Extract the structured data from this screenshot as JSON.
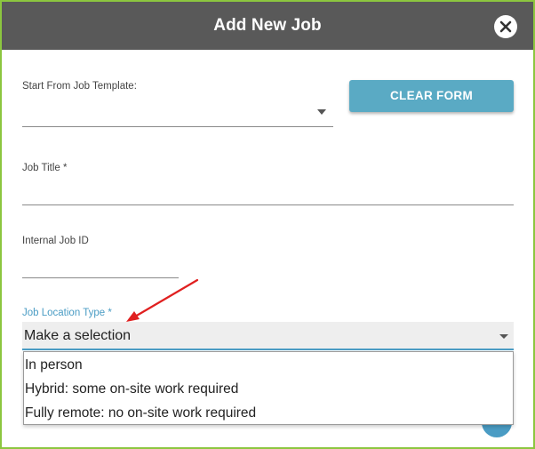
{
  "dialog": {
    "title": "Add New Job",
    "close_icon": "close-icon"
  },
  "form": {
    "template": {
      "label": "Start From Job Template:",
      "value": ""
    },
    "clear_button_label": "CLEAR FORM",
    "job_title": {
      "label": "Job Title *",
      "value": ""
    },
    "internal_id": {
      "label": "Internal Job ID",
      "value": ""
    },
    "location_type": {
      "label": "Job Location Type *",
      "selected": "Make a selection",
      "options": [
        "In person",
        "Hybrid: some on-site work required",
        "Fully remote: no on-site work required"
      ]
    }
  },
  "colors": {
    "border": "#8cc63f",
    "header_bg": "#595959",
    "accent": "#4a9cc4",
    "button_bg": "#5aaac4",
    "annotation_arrow": "#e02020"
  }
}
